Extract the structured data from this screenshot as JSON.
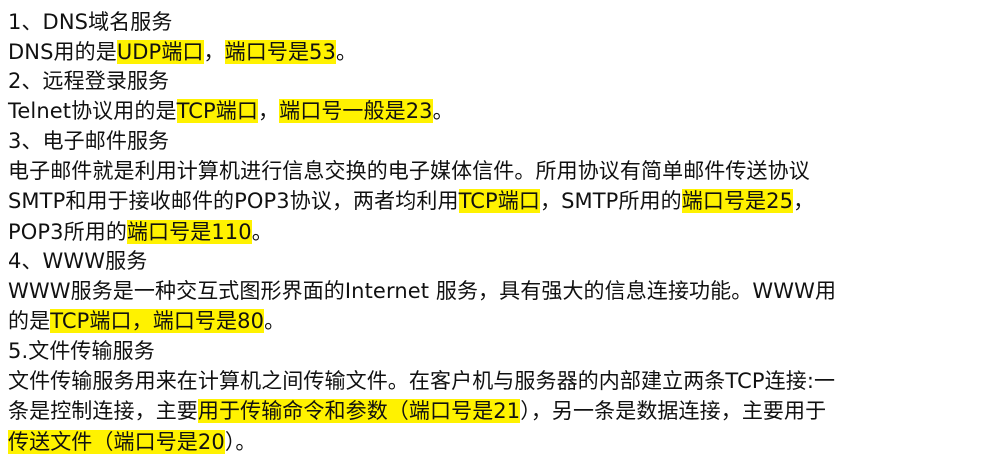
{
  "document": {
    "highlight_color": "#fff200",
    "lines": [
      {
        "kind": "heading",
        "segments": [
          {
            "text": "1、DNS域名服务",
            "hl": false
          }
        ]
      },
      {
        "kind": "body",
        "segments": [
          {
            "text": "DNS用的是",
            "hl": false
          },
          {
            "text": "UDP端口",
            "hl": true
          },
          {
            "text": "，",
            "hl": false
          },
          {
            "text": "端口号是53",
            "hl": true
          },
          {
            "text": "。",
            "hl": false
          }
        ]
      },
      {
        "kind": "heading",
        "segments": [
          {
            "text": "2、远程登录服务",
            "hl": false
          }
        ]
      },
      {
        "kind": "body",
        "segments": [
          {
            "text": "Telnet协议用的是",
            "hl": false
          },
          {
            "text": "TCP端口",
            "hl": true
          },
          {
            "text": "，",
            "hl": false
          },
          {
            "text": "端口号一般是23",
            "hl": true
          },
          {
            "text": "。",
            "hl": false
          }
        ]
      },
      {
        "kind": "heading",
        "segments": [
          {
            "text": "3、电子邮件服务",
            "hl": false
          }
        ]
      },
      {
        "kind": "body",
        "segments": [
          {
            "text": "电子邮件就是利用计算机进行信息交换的电子媒体信件。所用协议有简单邮件传送协议",
            "hl": false
          }
        ]
      },
      {
        "kind": "body",
        "segments": [
          {
            "text": "SMTP和用于接收邮件的POP3协议，两者均利用",
            "hl": false
          },
          {
            "text": "TCP端口",
            "hl": true
          },
          {
            "text": "，SMTP所用的",
            "hl": false
          },
          {
            "text": "端口号是25",
            "hl": true
          },
          {
            "text": "，",
            "hl": false
          }
        ]
      },
      {
        "kind": "body",
        "segments": [
          {
            "text": "POP3所用的",
            "hl": false
          },
          {
            "text": "端口号是110",
            "hl": true
          },
          {
            "text": "。",
            "hl": false
          }
        ]
      },
      {
        "kind": "heading",
        "segments": [
          {
            "text": "4、WWW服务",
            "hl": false
          }
        ]
      },
      {
        "kind": "body",
        "segments": [
          {
            "text": "WWW服务是一种交互式图形界面的Internet 服务，具有强大的信息连接功能。WWW用",
            "hl": false
          }
        ]
      },
      {
        "kind": "body",
        "segments": [
          {
            "text": "的是",
            "hl": false
          },
          {
            "text": "TCP端口，端口号是80",
            "hl": true
          },
          {
            "text": "。",
            "hl": false
          }
        ]
      },
      {
        "kind": "heading",
        "segments": [
          {
            "text": "5.文件传输服务",
            "hl": false
          }
        ]
      },
      {
        "kind": "body",
        "segments": [
          {
            "text": "文件传输服务用来在计算机之间传输文件。在客户机与服务器的内部建立两条TCP连接:一",
            "hl": false
          }
        ]
      },
      {
        "kind": "body",
        "segments": [
          {
            "text": "条是控制连接，主要",
            "hl": false
          },
          {
            "text": "用于传输命令和参数（端口号是21",
            "hl": true
          },
          {
            "text": "），另一条是数据连接，主要用于",
            "hl": false
          }
        ]
      },
      {
        "kind": "body",
        "segments": [
          {
            "text": "传送文件（端口号是20",
            "hl": true
          },
          {
            "text": "）。",
            "hl": false
          }
        ]
      }
    ]
  }
}
